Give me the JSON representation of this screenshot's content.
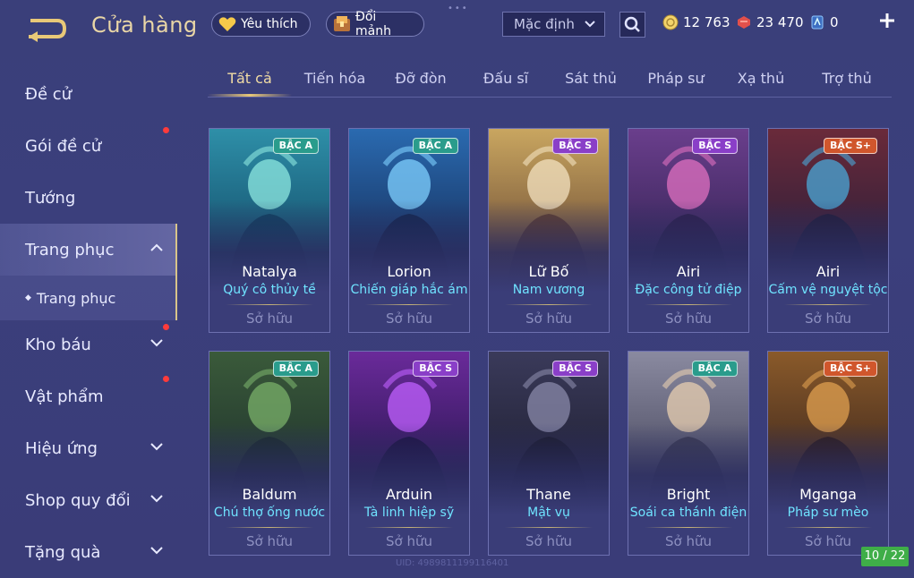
{
  "header": {
    "title": "Cửa hàng",
    "favorites_label": "Yêu thích",
    "exchange_label": "Đổi mảnh",
    "sort": {
      "selected": "Mặc định"
    },
    "currencies": [
      {
        "name": "gold",
        "value": "12 763",
        "color": "#f3d36b"
      },
      {
        "name": "vouchers",
        "value": "23 470",
        "color": "#e2504b"
      },
      {
        "name": "quan-huy",
        "value": "0",
        "color": "#8fc7ff"
      }
    ]
  },
  "sidebar": {
    "items": [
      {
        "label": "Đề cử"
      },
      {
        "label": "Gói đề cử"
      },
      {
        "label": "Tướng"
      },
      {
        "label": "Trang phục"
      },
      {
        "label": "Trang phục"
      },
      {
        "label": "Kho báu"
      },
      {
        "label": "Vật phẩm"
      },
      {
        "label": "Hiệu ứng"
      },
      {
        "label": "Shop quy đổi"
      },
      {
        "label": "Tặng quà"
      }
    ]
  },
  "tabs": [
    "Tất cả",
    "Tiến hóa",
    "Đỡ đòn",
    "Đấu sĩ",
    "Sát thủ",
    "Pháp sư",
    "Xạ thủ",
    "Trợ thủ"
  ],
  "cards": [
    {
      "hero": "Natalya",
      "skin": "Quý cô thủy tề",
      "tier": "BẬC A",
      "status": "Sở hữu"
    },
    {
      "hero": "Lorion",
      "skin": "Chiến giáp hắc ám",
      "tier": "BẬC A",
      "status": "Sở hữu"
    },
    {
      "hero": "Lữ Bố",
      "skin": "Nam vương",
      "tier": "BẬC S",
      "status": "Sở hữu"
    },
    {
      "hero": "Airi",
      "skin": "Đặc công tử điệp",
      "tier": "BẬC S",
      "status": "Sở hữu"
    },
    {
      "hero": "Airi",
      "skin": "Cấm vệ nguyệt tộc",
      "tier": "BẬC S+",
      "status": "Sở hữu"
    },
    {
      "hero": "Baldum",
      "skin": "Chú thợ ống nước",
      "tier": "BẬC A",
      "status": "Sở hữu"
    },
    {
      "hero": "Arduin",
      "skin": "Tà linh hiệp sỹ",
      "tier": "BẬC S",
      "status": "Sở hữu"
    },
    {
      "hero": "Thane",
      "skin": "Mật vụ",
      "tier": "BẬC S",
      "status": "Sở hữu"
    },
    {
      "hero": "Bright",
      "skin": "Soái ca thánh điện",
      "tier": "BẬC A",
      "status": "Sở hữu"
    },
    {
      "hero": "Mganga",
      "skin": "Pháp sư mèo",
      "tier": "BẬC S+",
      "status": "Sở hữu"
    }
  ],
  "page_indicator": "10 / 22",
  "uid": "UID: 4989811199116401",
  "colors": {
    "accent": "#e8c878",
    "skin_name": "#6fe3ff",
    "badge_a": "#2a9c8c",
    "badge_s": "#8a3fc8",
    "badge_splus": "#d0562c"
  }
}
